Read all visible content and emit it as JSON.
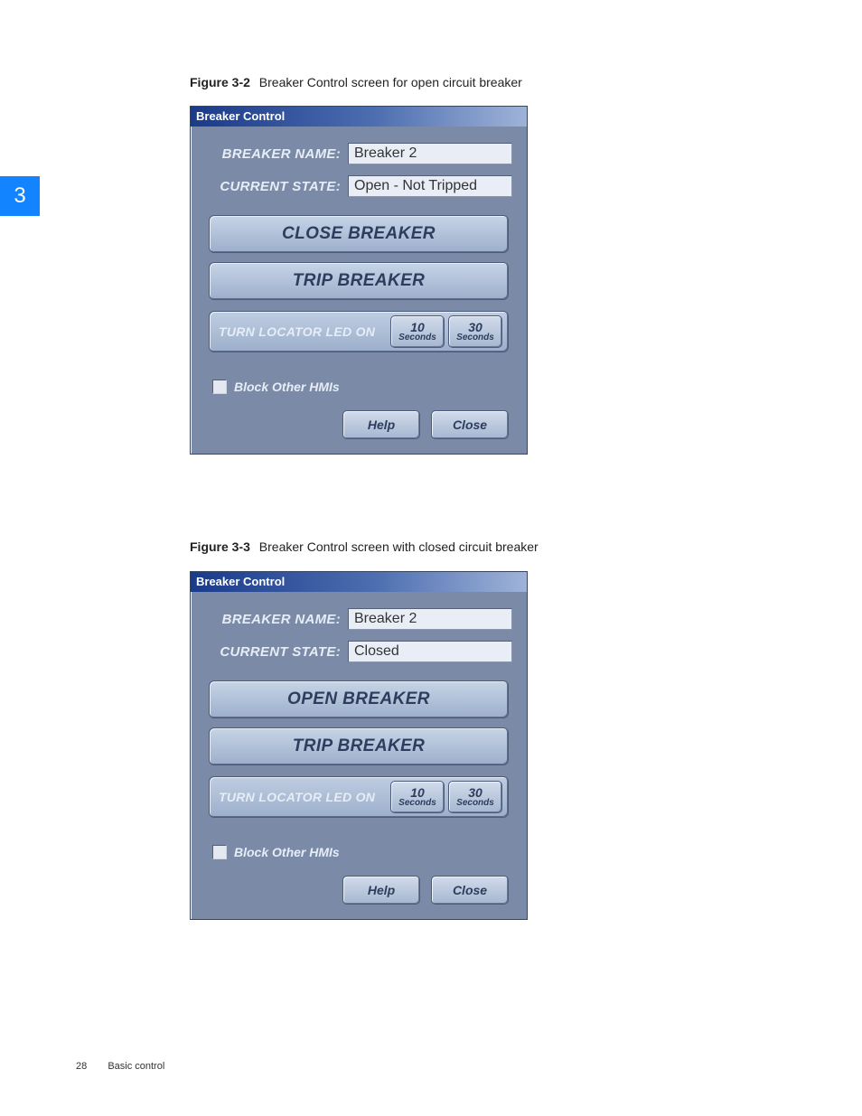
{
  "chapter_number": "3",
  "captions": {
    "fig1_label": "Figure 3-2",
    "fig1_text": "Breaker Control screen for open circuit breaker",
    "fig2_label": "Figure 3-3",
    "fig2_text": "Breaker Control screen with closed circuit breaker"
  },
  "dialog1": {
    "title": "Breaker Control",
    "labels": {
      "name": "BREAKER NAME:",
      "state": "CURRENT STATE:"
    },
    "values": {
      "name": "Breaker 2",
      "state": "Open - Not Tripped"
    },
    "buttons": {
      "primary": "CLOSE BREAKER",
      "trip": "TRIP BREAKER"
    },
    "locator": {
      "label": "TURN LOCATOR LED ON",
      "opt1_num": "10",
      "opt1_unit": "Seconds",
      "opt2_num": "30",
      "opt2_unit": "Seconds"
    },
    "checkbox_label": "Block Other HMIs",
    "help": "Help",
    "close": "Close"
  },
  "dialog2": {
    "title": "Breaker Control",
    "labels": {
      "name": "BREAKER NAME:",
      "state": "CURRENT STATE:"
    },
    "values": {
      "name": "Breaker 2",
      "state": "Closed"
    },
    "buttons": {
      "primary": "OPEN BREAKER",
      "trip": "TRIP BREAKER"
    },
    "locator": {
      "label": "TURN LOCATOR LED ON",
      "opt1_num": "10",
      "opt1_unit": "Seconds",
      "opt2_num": "30",
      "opt2_unit": "Seconds"
    },
    "checkbox_label": "Block Other HMIs",
    "help": "Help",
    "close": "Close"
  },
  "footer": {
    "page": "28",
    "section": "Basic control"
  }
}
